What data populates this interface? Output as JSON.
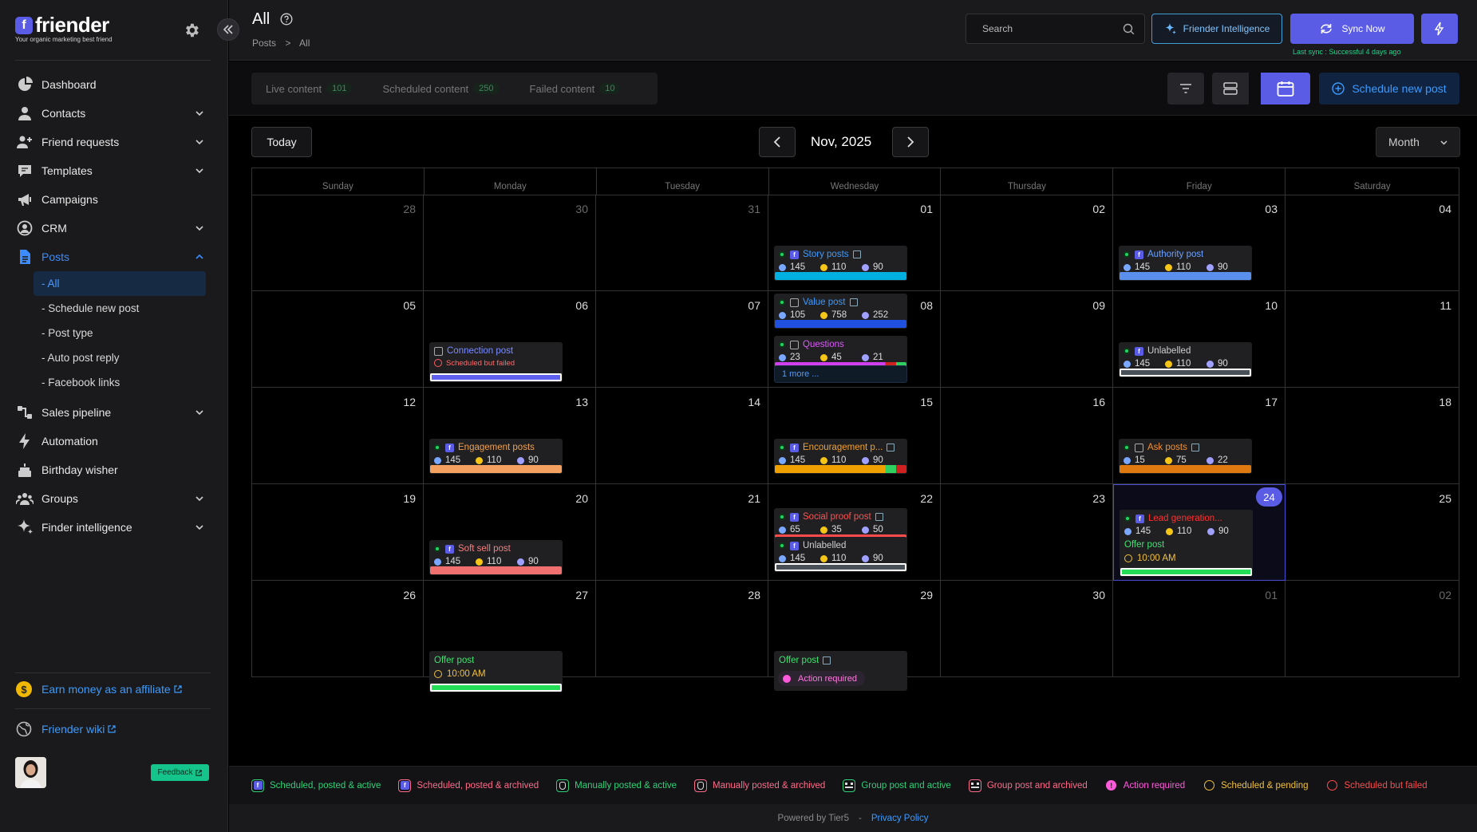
{
  "brand": {
    "name": "friender",
    "tagline": "Your organic marketing best friend"
  },
  "sidebar": {
    "items": [
      {
        "label": "Dashboard",
        "icon": "pie-chart-icon",
        "chevron": false
      },
      {
        "label": "Contacts",
        "icon": "person-icon",
        "chevron": true
      },
      {
        "label": "Friend requests",
        "icon": "add-friend-icon",
        "chevron": true
      },
      {
        "label": "Templates",
        "icon": "chat-icon",
        "chevron": true
      },
      {
        "label": "Campaigns",
        "icon": "megaphone-icon",
        "chevron": false
      },
      {
        "label": "CRM",
        "icon": "user-circle-icon",
        "chevron": true
      },
      {
        "label": "Posts",
        "icon": "document-icon",
        "chevron": true,
        "active": true
      }
    ],
    "sub_items": [
      "- All",
      "- Schedule new post",
      "- Post type",
      "- Auto post reply",
      "- Facebook links"
    ],
    "items2": [
      {
        "label": "Sales pipeline",
        "icon": "pipeline-icon",
        "chevron": true
      },
      {
        "label": "Automation",
        "icon": "bolt-icon",
        "chevron": false
      },
      {
        "label": "Birthday wisher",
        "icon": "cake-icon",
        "chevron": false
      },
      {
        "label": "Groups",
        "icon": "group-icon",
        "chevron": true
      },
      {
        "label": "Finder intelligence",
        "icon": "sparkle-icon",
        "chevron": true
      }
    ],
    "affiliate": "Earn money as an affiliate",
    "wiki": "Friender wiki",
    "feedback": "Feedback"
  },
  "header": {
    "title": "All",
    "breadcrumb": [
      "Posts",
      ">",
      "All"
    ],
    "search_placeholder": "Search",
    "fi_label": "Friender Intelligence",
    "sync_label": "Sync Now",
    "last_sync": "Last sync : Successful 4 days ago"
  },
  "toolbar": {
    "tabs": [
      {
        "label": "Live content",
        "count": "101"
      },
      {
        "label": "Scheduled content",
        "count": "250"
      },
      {
        "label": "Failed content",
        "count": "10"
      }
    ],
    "schedule_label": "Schedule new post"
  },
  "calendar": {
    "today_label": "Today",
    "month_label": "Nov, 2025",
    "view": "Month",
    "weekdays": [
      "Sunday",
      "Monday",
      "Tuesday",
      "Wednesday",
      "Thursday",
      "Friday",
      "Saturday"
    ],
    "weeks": [
      [
        "28",
        "30",
        "31",
        "01",
        "02",
        "03",
        "04"
      ],
      [
        "05",
        "06",
        "07",
        "08",
        "09",
        "10",
        "11"
      ],
      [
        "12",
        "13",
        "14",
        "15",
        "16",
        "17",
        "18"
      ],
      [
        "19",
        "20",
        "21",
        "22",
        "23",
        "24",
        "25"
      ],
      [
        "26",
        "27",
        "28",
        "29",
        "30",
        "01",
        "02"
      ]
    ],
    "muted": [
      [
        0,
        0
      ],
      [
        0,
        1
      ],
      [
        0,
        2
      ],
      [
        4,
        5
      ],
      [
        4,
        6
      ]
    ],
    "today": [
      3,
      5
    ],
    "events": [
      {
        "week": 0,
        "day": 3,
        "slot": 0,
        "type": "fb",
        "title": "Story posts",
        "title_color": "#3b9bff",
        "chart": true,
        "stats": [
          "145",
          "110",
          "90"
        ],
        "bar": [
          "#00b0e0"
        ]
      },
      {
        "week": 0,
        "day": 5,
        "slot": 0,
        "type": "fb",
        "title": "Authority post",
        "title_color": "#6aa0ff",
        "chart": false,
        "stats": [
          "145",
          "110",
          "90"
        ],
        "bar": [
          "#5b8fee"
        ]
      },
      {
        "week": 1,
        "day": 3,
        "slot": -1,
        "type": "grp",
        "title": "Value post",
        "title_color": "#3b9bff",
        "chart": true,
        "stats": [
          "105",
          "758",
          "252"
        ],
        "bar": [
          "#2050e0"
        ]
      },
      {
        "week": 1,
        "day": 3,
        "slot": 0,
        "type": "grp",
        "title": "Questions",
        "title_color": "#d45cf0",
        "chart": false,
        "stats": [
          "23",
          "45",
          "21"
        ],
        "bar": [
          "#d040ee",
          "#30d060",
          "#d02020"
        ]
      },
      {
        "week": 1,
        "day": 1,
        "slot": 1,
        "type": "fail",
        "title": "Connection post",
        "title_color": "#7a8cff",
        "fail_text": "Scheduled but failed",
        "bar": [
          "#6060f0"
        ]
      },
      {
        "week": 1,
        "day": 5,
        "slot": 0,
        "type": "fb",
        "title": "Unlabelled",
        "title_color": "#cfcfcf",
        "chart": false,
        "stats": [
          "145",
          "110",
          "90"
        ],
        "bar": [
          "#4a5058"
        ]
      },
      {
        "week": 2,
        "day": 1,
        "slot": 0,
        "type": "fb",
        "title": "Engagement posts",
        "title_color": "#f0a050",
        "chart": false,
        "stats": [
          "145",
          "110",
          "90"
        ],
        "bar": [
          "#f4a060"
        ]
      },
      {
        "week": 2,
        "day": 3,
        "slot": 0,
        "type": "fb",
        "title": "Encouragement p...",
        "title_color": "#f0a030",
        "chart": true,
        "stats": [
          "145",
          "110",
          "90"
        ],
        "bar": [
          "#f0a000",
          "#d02020",
          "#30d060"
        ]
      },
      {
        "week": 2,
        "day": 5,
        "slot": 0,
        "type": "grp",
        "title": "Ask posts",
        "title_color": "#f09030",
        "chart": true,
        "stats": [
          "15",
          "75",
          "22"
        ],
        "bar": [
          "#e07a10"
        ]
      },
      {
        "week": 3,
        "day": 1,
        "slot": 1,
        "type": "fb",
        "title": "Soft sell post",
        "title_color": "#f08080",
        "chart": false,
        "stats": [
          "145",
          "110",
          "90"
        ],
        "bar": [
          "#f07070"
        ]
      },
      {
        "week": 3,
        "day": 3,
        "slot": -1,
        "type": "fb",
        "title": "Social proof post",
        "title_color": "#ff5050",
        "chart": true,
        "stats": [
          "65",
          "35",
          "50"
        ],
        "bar": [
          "#ff4b4b"
        ]
      },
      {
        "week": 3,
        "day": 3,
        "slot": 0,
        "type": "fb",
        "title": "Unlabelled",
        "title_color": "#cfcfcf",
        "chart": false,
        "stats": [
          "145",
          "110",
          "90"
        ],
        "bar": [
          "#4a5058"
        ]
      },
      {
        "week": 3,
        "day": 5,
        "slot": -1,
        "type": "fb",
        "title": "Lead generation...",
        "title_color": "#ff3030",
        "chart": false,
        "stats": [
          "145",
          "110",
          "90"
        ],
        "bar": [
          "#ff1a1a"
        ]
      },
      {
        "week": 3,
        "day": 5,
        "slot": 0,
        "type": "offer",
        "title": "Offer post",
        "title_color": "#40e070",
        "time": "10:00 AM",
        "bar": [
          "#22dd55"
        ]
      },
      {
        "week": 4,
        "day": 1,
        "slot": 0,
        "type": "offer",
        "title": "Offer post",
        "title_color": "#40e070",
        "time": "10:00 AM",
        "bar": [
          "#22dd55"
        ]
      },
      {
        "week": 4,
        "day": 3,
        "slot": 0,
        "type": "action",
        "title": "Offer post",
        "title_color": "#40e070",
        "action": "Action required"
      }
    ],
    "more": {
      "week": 1,
      "day": 3,
      "label": "1 more ..."
    }
  },
  "legend": [
    {
      "label": "Scheduled, posted & active",
      "color": "#2fd07a",
      "icon": "facebook-icon"
    },
    {
      "label": "Scheduled, posted & archived",
      "color": "#ff6b8a",
      "icon": "facebook-icon"
    },
    {
      "label": "Manually posted & active",
      "color": "#2fd07a",
      "icon": "hand-pointer-icon"
    },
    {
      "label": "Manually posted & archived",
      "color": "#ff6b8a",
      "icon": "hand-pointer-icon"
    },
    {
      "label": "Group post and active",
      "color": "#2fd07a",
      "icon": "group-icon"
    },
    {
      "label": "Group post and archived",
      "color": "#ff6b8a",
      "icon": "group-icon"
    },
    {
      "label": "Action required",
      "color": "#ff5adc",
      "icon": "alert-icon"
    },
    {
      "label": "Scheduled & pending",
      "color": "#f0c040",
      "icon": "clock-icon"
    },
    {
      "label": "Scheduled but failed",
      "color": "#ff4b4b",
      "icon": "ban-icon"
    }
  ],
  "footer": {
    "powered": "Powered by Tier5",
    "sep": "-",
    "privacy": "Privacy Policy"
  }
}
